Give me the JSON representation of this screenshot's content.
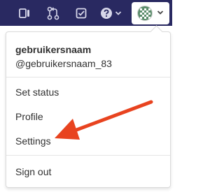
{
  "topbar": {
    "icons": [
      "sidebar-toggle-icon",
      "merge-request-icon",
      "todo-icon",
      "help-icon"
    ],
    "help_caret": "chevron-down-icon",
    "avatar_caret": "chevron-down-icon"
  },
  "dropdown": {
    "username": "gebruikersnaam",
    "handle": "@gebruikersnaam_83",
    "items": [
      {
        "label": "Set status"
      },
      {
        "label": "Profile"
      },
      {
        "label": "Settings"
      },
      {
        "label": "Sign out"
      }
    ]
  },
  "colors": {
    "topbar_bg": "#292961",
    "annotation_arrow": "#e8431f"
  }
}
